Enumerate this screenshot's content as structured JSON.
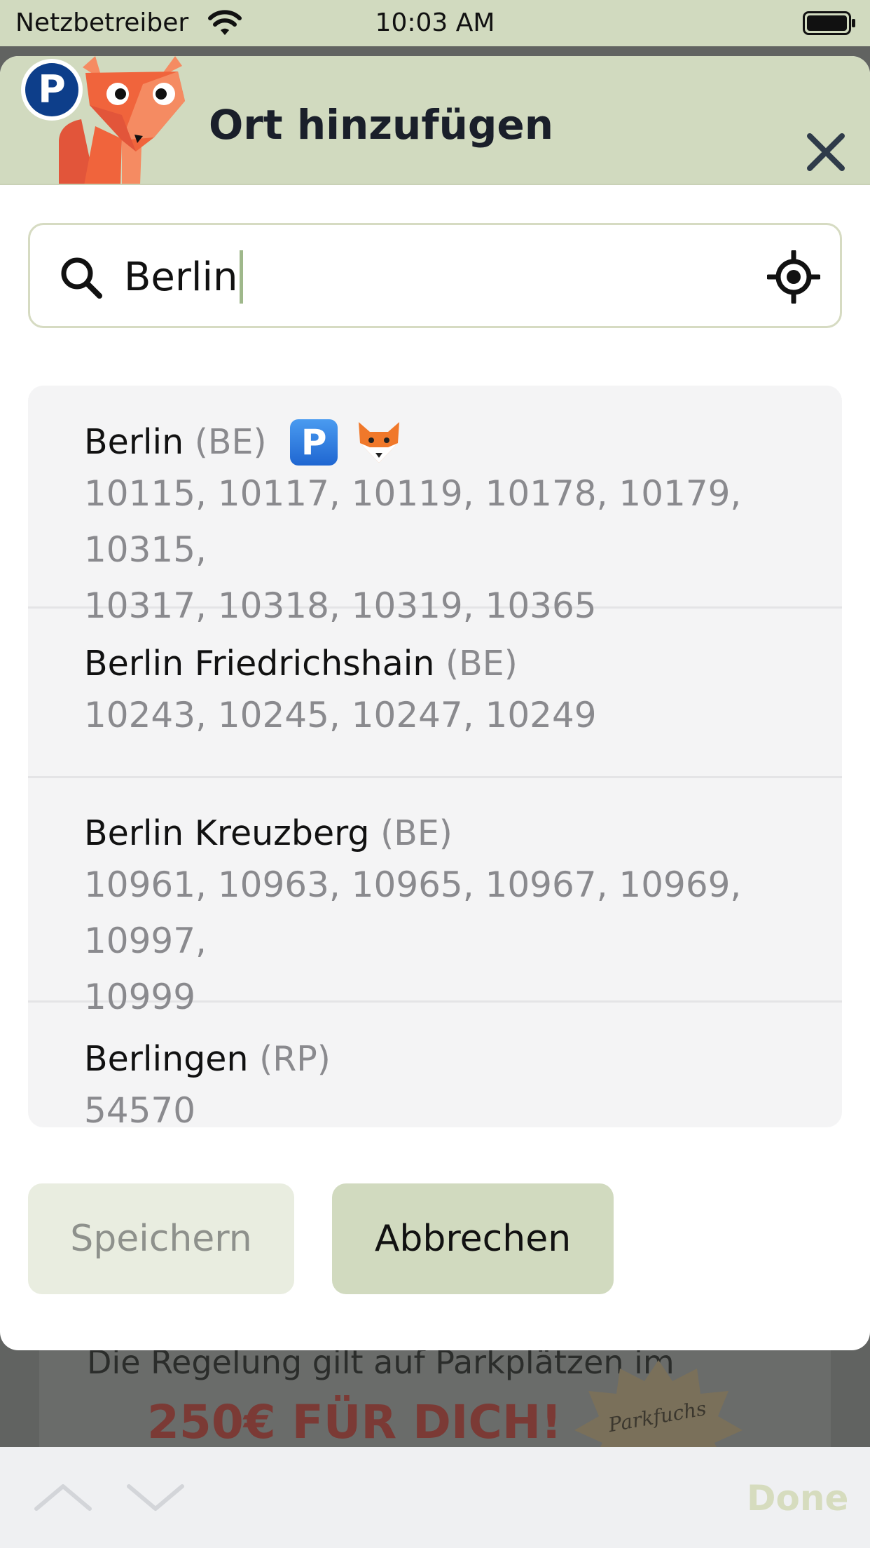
{
  "status_bar": {
    "carrier": "Netzbetreiber",
    "time": "10:03 AM"
  },
  "background_page": {
    "text": "Die Regelung gilt auf Parkplätzen im",
    "promo": "250€ FÜR DICH!",
    "badge_text": "Parkfuchs"
  },
  "modal": {
    "title": "Ort hinzufügen",
    "search": {
      "value": "Berlin"
    },
    "results": [
      {
        "name": "Berlin",
        "state": "(BE)",
        "zips_line1": "10115, 10117, 10119, 10178, 10179, 10315,",
        "zips_line2": "10317, 10318, 10319, 10365",
        "tag_parking": "P"
      },
      {
        "name": "Berlin Friedrichshain",
        "state": "(BE)",
        "zips_line1": "10243, 10245, 10247, 10249"
      },
      {
        "name": "Berlin Kreuzberg",
        "state": "(BE)",
        "zips_line1": "10961, 10963, 10965, 10967, 10969, 10997,",
        "zips_line2": "10999"
      },
      {
        "name": "Berlingen",
        "state": "(RP)",
        "zips_line1": "54570"
      }
    ],
    "buttons": {
      "save": "Speichern",
      "cancel": "Abbrechen"
    }
  },
  "accessory_bar": {
    "done": "Done"
  },
  "colors": {
    "header_bg": "#d1dabf",
    "brand_blue": "#0d3e8a",
    "fox_orange": "#f0643c",
    "muted_text": "#8a8a8e"
  },
  "icons": [
    "wifi-icon",
    "battery-icon",
    "parking-logo-icon",
    "fox-logo-icon",
    "close-icon",
    "search-icon",
    "locate-icon",
    "parking-tag-icon",
    "fox-tag-icon",
    "chevron-up-icon",
    "chevron-down-icon"
  ]
}
